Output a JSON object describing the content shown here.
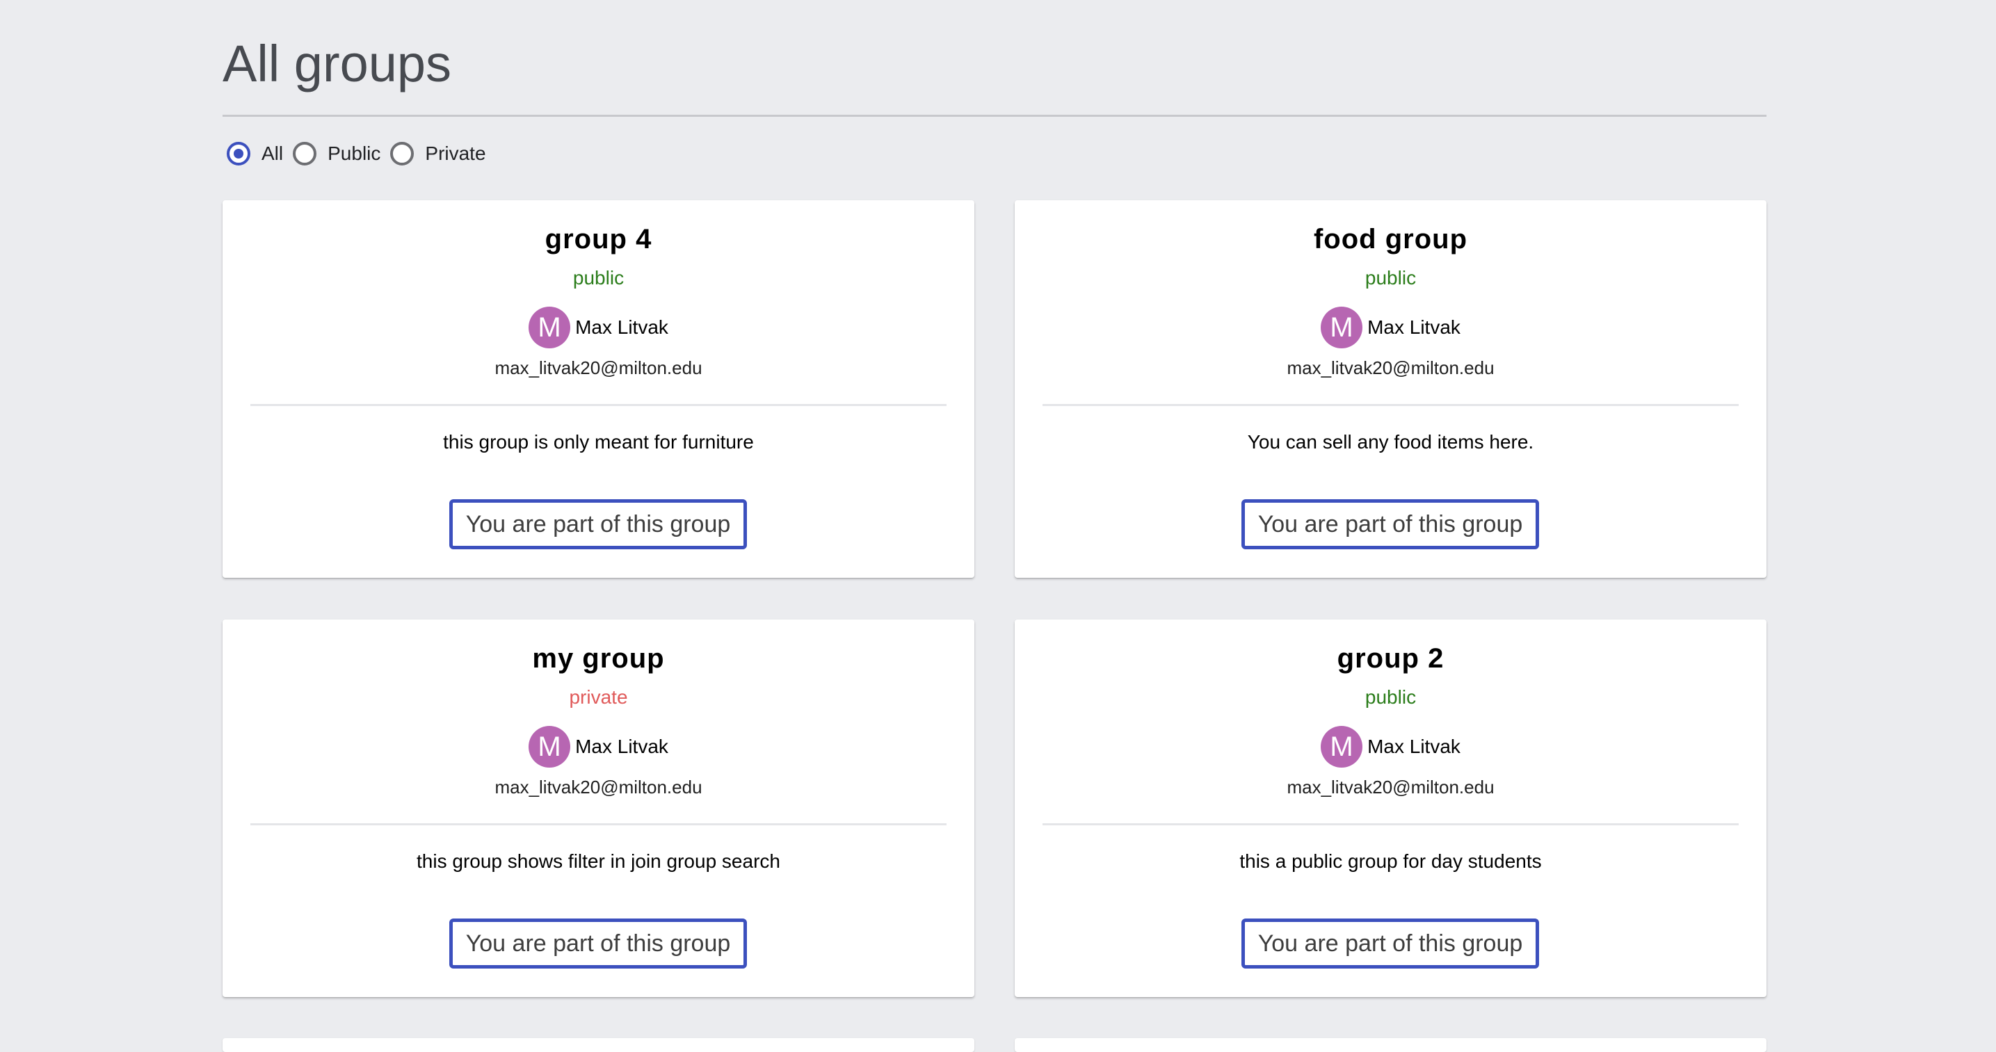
{
  "page": {
    "title": "All groups"
  },
  "filter": {
    "options": [
      {
        "label": "All",
        "checked": true
      },
      {
        "label": "Public",
        "checked": false
      },
      {
        "label": "Private",
        "checked": false
      }
    ]
  },
  "groups": [
    {
      "name": "group 4",
      "visibility": "public",
      "owner_initial": "M",
      "owner_name": "Max Litvak",
      "owner_email": "max_litvak20@milton.edu",
      "description": "this group is only meant for furniture",
      "button_label": "You are part of this group"
    },
    {
      "name": "food group",
      "visibility": "public",
      "owner_initial": "M",
      "owner_name": "Max Litvak",
      "owner_email": "max_litvak20@milton.edu",
      "description": "You can sell any food items here.",
      "button_label": "You are part of this group"
    },
    {
      "name": "my group",
      "visibility": "private",
      "owner_initial": "M",
      "owner_name": "Max Litvak",
      "owner_email": "max_litvak20@milton.edu",
      "description": "this group shows filter in join group search",
      "button_label": "You are part of this group"
    },
    {
      "name": "group 2",
      "visibility": "public",
      "owner_initial": "M",
      "owner_name": "Max Litvak",
      "owner_email": "max_litvak20@milton.edu",
      "description": "this a public group for day students",
      "button_label": "You are part of this group"
    }
  ],
  "colors": {
    "accent": "#3c50be",
    "public": "#2b7d1b",
    "private": "#e05a5a",
    "avatar": "#b766b2",
    "background": "#ebecef"
  }
}
